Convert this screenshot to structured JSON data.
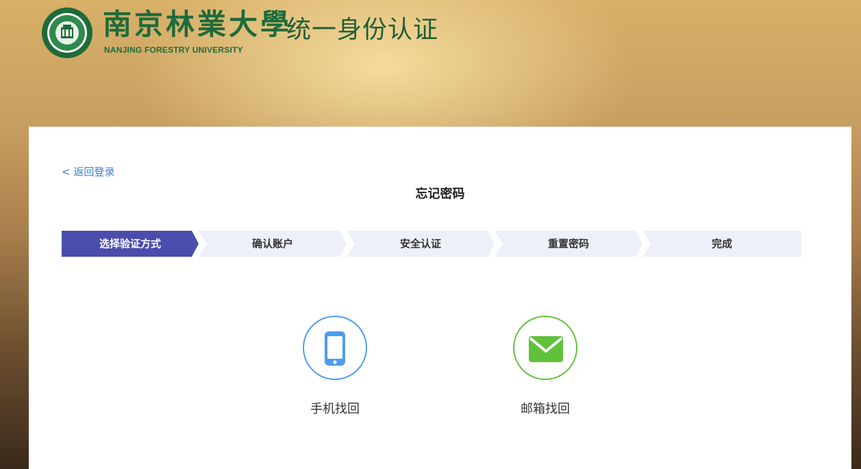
{
  "header": {
    "logo_cn": "南京林業大學",
    "logo_en": "NANJING FORESTRY UNIVERSITY",
    "system_title": "统一身份认证"
  },
  "card": {
    "back_link": "< 返回登录",
    "title": "忘记密码",
    "steps": [
      {
        "label": "选择验证方式",
        "active": true
      },
      {
        "label": "确认账户",
        "active": false
      },
      {
        "label": "安全认证",
        "active": false
      },
      {
        "label": "重置密码",
        "active": false
      },
      {
        "label": "完成",
        "active": false
      }
    ],
    "options": [
      {
        "label": "手机找回",
        "icon": "phone-icon",
        "color": "#4e9cf0"
      },
      {
        "label": "邮箱找回",
        "icon": "mail-icon",
        "color": "#61c13a"
      }
    ]
  },
  "colors": {
    "step_active": "#4a4dab",
    "step_inactive": "#eef0f9",
    "link": "#3a7fd6",
    "brand_green": "#1d6b3a"
  }
}
